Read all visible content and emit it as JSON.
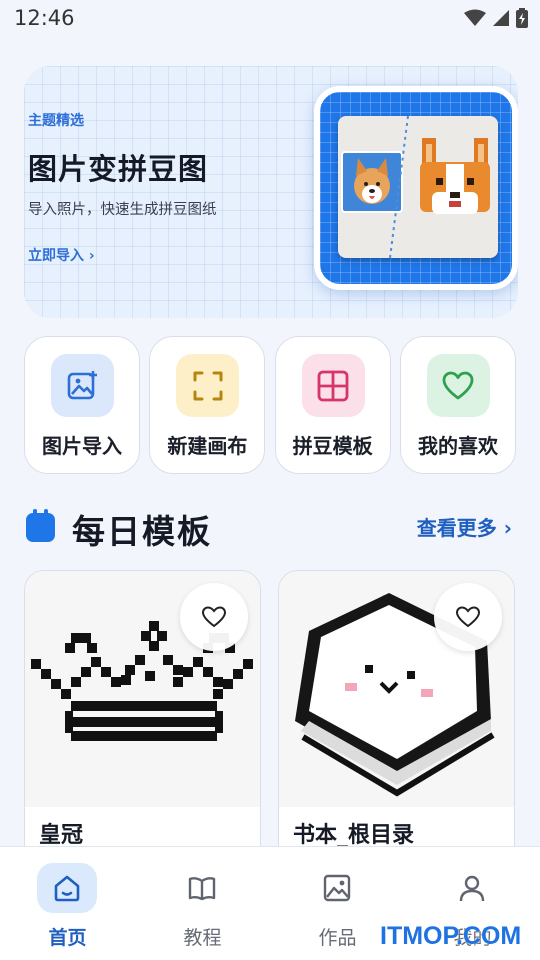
{
  "status_bar": {
    "time": "12:46"
  },
  "banner": {
    "tag": "主题精选",
    "title": "图片变拼豆图",
    "subtitle": "导入照片，快速生成拼豆图纸",
    "cta": "立即导入 ›"
  },
  "actions": [
    {
      "label": "图片导入",
      "icon": "image-add-icon",
      "bg": "#dbe8fb",
      "color": "#2d6fd6"
    },
    {
      "label": "新建画布",
      "icon": "frame-corners-icon",
      "bg": "#fdf0c8",
      "color": "#b7850f"
    },
    {
      "label": "拼豆模板",
      "icon": "grid-template-icon",
      "bg": "#fbdfe9",
      "color": "#d6346b"
    },
    {
      "label": "我的喜欢",
      "icon": "heart-icon",
      "bg": "#dcf3e3",
      "color": "#2ea14f"
    }
  ],
  "section": {
    "title": "每日模板",
    "more": "查看更多 ›"
  },
  "templates": [
    {
      "name": "皇冠"
    },
    {
      "name": "书本_根目录"
    }
  ],
  "bottom_nav": [
    {
      "label": "首页",
      "icon": "home-icon",
      "active": true
    },
    {
      "label": "教程",
      "icon": "book-icon",
      "active": false
    },
    {
      "label": "作品",
      "icon": "gallery-icon",
      "active": false
    },
    {
      "label": "我的",
      "icon": "user-icon",
      "active": false
    }
  ],
  "watermark": "ITMOP.COM",
  "colors": {
    "accent": "#1f76e8",
    "link": "#1f5fbf",
    "background": "#f2f5fb"
  }
}
